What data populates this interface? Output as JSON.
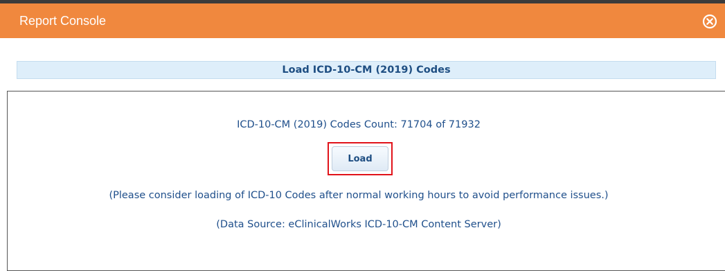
{
  "window": {
    "title": "Report Console",
    "close_icon": "close-circle-icon"
  },
  "section": {
    "header": "Load ICD-10-CM (2019) Codes"
  },
  "content": {
    "count_text": "ICD-10-CM (2019) Codes Count: 71704 of 71932",
    "load_button_label": "Load",
    "note_text": "(Please consider loading of ICD-10 Codes after normal working hours to avoid performance issues.)",
    "source_text": "(Data Source: eClinicalWorks ICD-10-CM Content Server)"
  },
  "colors": {
    "title_bar": "#f0883e",
    "header_band": "#deeefa",
    "text_blue": "#1f4f8b",
    "highlight": "#e1131a"
  }
}
